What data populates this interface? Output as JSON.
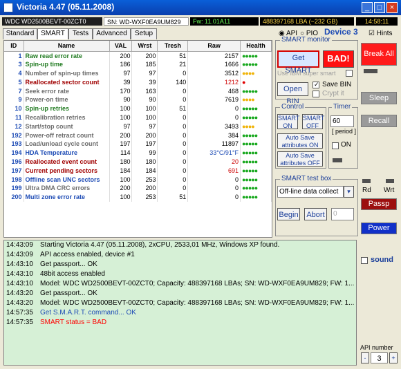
{
  "window": {
    "title": "Victoria 4.47 (05.11.2008)"
  },
  "statusbar": {
    "model": "WDC WD2500BEVT-00ZCT0",
    "serial": "SN: WD-WXF0EA9UM829",
    "firmware": "Fw: 11.01A11",
    "lba": "488397168 LBA (~232 GB)",
    "time": "14:58:11"
  },
  "tabs": [
    "Standard",
    "SMART",
    "Tests",
    "Advanced",
    "Setup"
  ],
  "mode": {
    "api": "API",
    "pio": "PIO",
    "device": "Device 3",
    "hints": "Hints"
  },
  "table": {
    "headers": [
      "ID",
      "Name",
      "VAL",
      "Wrst",
      "Tresh",
      "Raw",
      "Health"
    ],
    "rows": [
      {
        "id": "1",
        "name": "Raw read error rate",
        "val": "200",
        "wrst": "200",
        "tresh": "51",
        "raw": "2157",
        "health": "●●●●●",
        "name_color": "green",
        "health_color": "green"
      },
      {
        "id": "3",
        "name": "Spin-up time",
        "val": "186",
        "wrst": "185",
        "tresh": "21",
        "raw": "1666",
        "health": "●●●●●",
        "name_color": "green",
        "health_color": "green"
      },
      {
        "id": "4",
        "name": "Number of spin-up times",
        "val": "97",
        "wrst": "97",
        "tresh": "0",
        "raw": "3512",
        "health": "●●●●",
        "name_color": "gray",
        "health_color": "yellow"
      },
      {
        "id": "5",
        "name": "Reallocated sector count",
        "val": "39",
        "wrst": "39",
        "tresh": "140",
        "raw": "1212",
        "health": "●",
        "name_color": "maroon",
        "health_color": "red"
      },
      {
        "id": "7",
        "name": "Seek error rate",
        "val": "170",
        "wrst": "163",
        "tresh": "0",
        "raw": "468",
        "health": "●●●●●",
        "name_color": "gray",
        "health_color": "green"
      },
      {
        "id": "9",
        "name": "Power-on time",
        "val": "90",
        "wrst": "90",
        "tresh": "0",
        "raw": "7619",
        "health": "●●●●",
        "name_color": "gray",
        "health_color": "yellow"
      },
      {
        "id": "10",
        "name": "Spin-up retries",
        "val": "100",
        "wrst": "100",
        "tresh": "51",
        "raw": "0",
        "health": "●●●●●",
        "name_color": "green",
        "health_color": "green"
      },
      {
        "id": "11",
        "name": "Recalibration retries",
        "val": "100",
        "wrst": "100",
        "tresh": "0",
        "raw": "0",
        "health": "●●●●●",
        "name_color": "gray",
        "health_color": "green"
      },
      {
        "id": "12",
        "name": "Start/stop count",
        "val": "97",
        "wrst": "97",
        "tresh": "0",
        "raw": "3493",
        "health": "●●●●",
        "name_color": "gray",
        "health_color": "yellow"
      },
      {
        "id": "192",
        "name": "Power-off retract count",
        "val": "200",
        "wrst": "200",
        "tresh": "0",
        "raw": "384",
        "health": "●●●●●",
        "name_color": "gray",
        "health_color": "green"
      },
      {
        "id": "193",
        "name": "Load/unload cycle count",
        "val": "197",
        "wrst": "197",
        "tresh": "0",
        "raw": "11897",
        "health": "●●●●●",
        "name_color": "gray",
        "health_color": "green"
      },
      {
        "id": "194",
        "name": "HDA Temperature",
        "val": "114",
        "wrst": "99",
        "tresh": "0",
        "raw": "33°C/91°F",
        "health": "●●●●●",
        "name_color": "blue",
        "health_color": "green"
      },
      {
        "id": "196",
        "name": "Reallocated event count",
        "val": "180",
        "wrst": "180",
        "tresh": "0",
        "raw": "20",
        "health": "●●●●●",
        "name_color": "maroon",
        "health_color": "green"
      },
      {
        "id": "197",
        "name": "Current pending sectors",
        "val": "184",
        "wrst": "184",
        "tresh": "0",
        "raw": "691",
        "health": "●●●●●",
        "name_color": "maroon",
        "health_color": "green"
      },
      {
        "id": "198",
        "name": "Offline scan UNC sectors",
        "val": "100",
        "wrst": "253",
        "tresh": "0",
        "raw": "0",
        "health": "●●●●●",
        "name_color": "blue",
        "health_color": "green"
      },
      {
        "id": "199",
        "name": "Ultra DMA CRC errors",
        "val": "200",
        "wrst": "200",
        "tresh": "0",
        "raw": "0",
        "health": "●●●●●",
        "name_color": "gray",
        "health_color": "green"
      },
      {
        "id": "200",
        "name": "Multi zone error rate",
        "val": "100",
        "wrst": "253",
        "tresh": "51",
        "raw": "0",
        "health": "●●●●●",
        "name_color": "blue",
        "health_color": "green"
      }
    ]
  },
  "smart_monitor": {
    "label": "SMART monitor",
    "get_smart": "Get SMART",
    "status": "BAD!",
    "use_ibm": "Use IBM super smart",
    "open_bin": "Open BIN",
    "save_bin": "Save BIN",
    "crypt_it": "Crypt it"
  },
  "control": {
    "label": "Control",
    "smart_on": "SMART\nON",
    "smart_off": "SMART\nOFF",
    "autosave_on": "Auto Save\nattributes ON",
    "autosave_off": "Auto Save\nattributes OFF"
  },
  "timer": {
    "label": "Timer",
    "value": "60",
    "period": "[ period ]",
    "on": "ON"
  },
  "test_box": {
    "label": "SMART test box",
    "selected": "Off-line data collect",
    "begin": "Begin",
    "abort": "Abort",
    "extra": "0"
  },
  "right_panel": {
    "break_all": "Break All",
    "sleep": "Sleep",
    "recall": "Recall",
    "rd": "Rd",
    "wrt": "Wrt",
    "passp": "Passp",
    "power": "Power",
    "sound": "sound",
    "api_number_label": "API number",
    "api_number_value": "3",
    "api_minus": "-",
    "api_plus": "+"
  },
  "log": [
    {
      "time": "14:43:09",
      "msg": "Starting Victoria 4.47 (05.11.2008), 2xCPU, 2533,01 MHz, Windows XP found.",
      "color": "#000000"
    },
    {
      "time": "14:43:09",
      "msg": "API access enabled, device #1",
      "color": "#000000"
    },
    {
      "time": "14:43:10",
      "msg": "Get passport... OK",
      "color": "#000000"
    },
    {
      "time": "14:43:10",
      "msg": "48bit access enabled",
      "color": "#000000"
    },
    {
      "time": "14:43:10",
      "msg": "Model: WDC WD2500BEVT-00ZCT0; Capacity: 488397168 LBAs; SN: WD-WXF0EA9UM829; FW: 1...",
      "color": "#000000"
    },
    {
      "time": "14:43:20",
      "msg": "Get passport... OK",
      "color": "#000000"
    },
    {
      "time": "14:43:20",
      "msg": "Model: WDC WD2500BEVT-00ZCT0; Capacity: 488397168 LBAs; SN: WD-WXF0EA9UM829; FW: 1...",
      "color": "#000000"
    },
    {
      "time": "14:57:35",
      "msg": "Get S.M.A.R.T. command... OK",
      "color": "#1d4bb5"
    },
    {
      "time": "14:57:35",
      "msg": "SMART status = BAD",
      "color": "#ff0000"
    }
  ]
}
